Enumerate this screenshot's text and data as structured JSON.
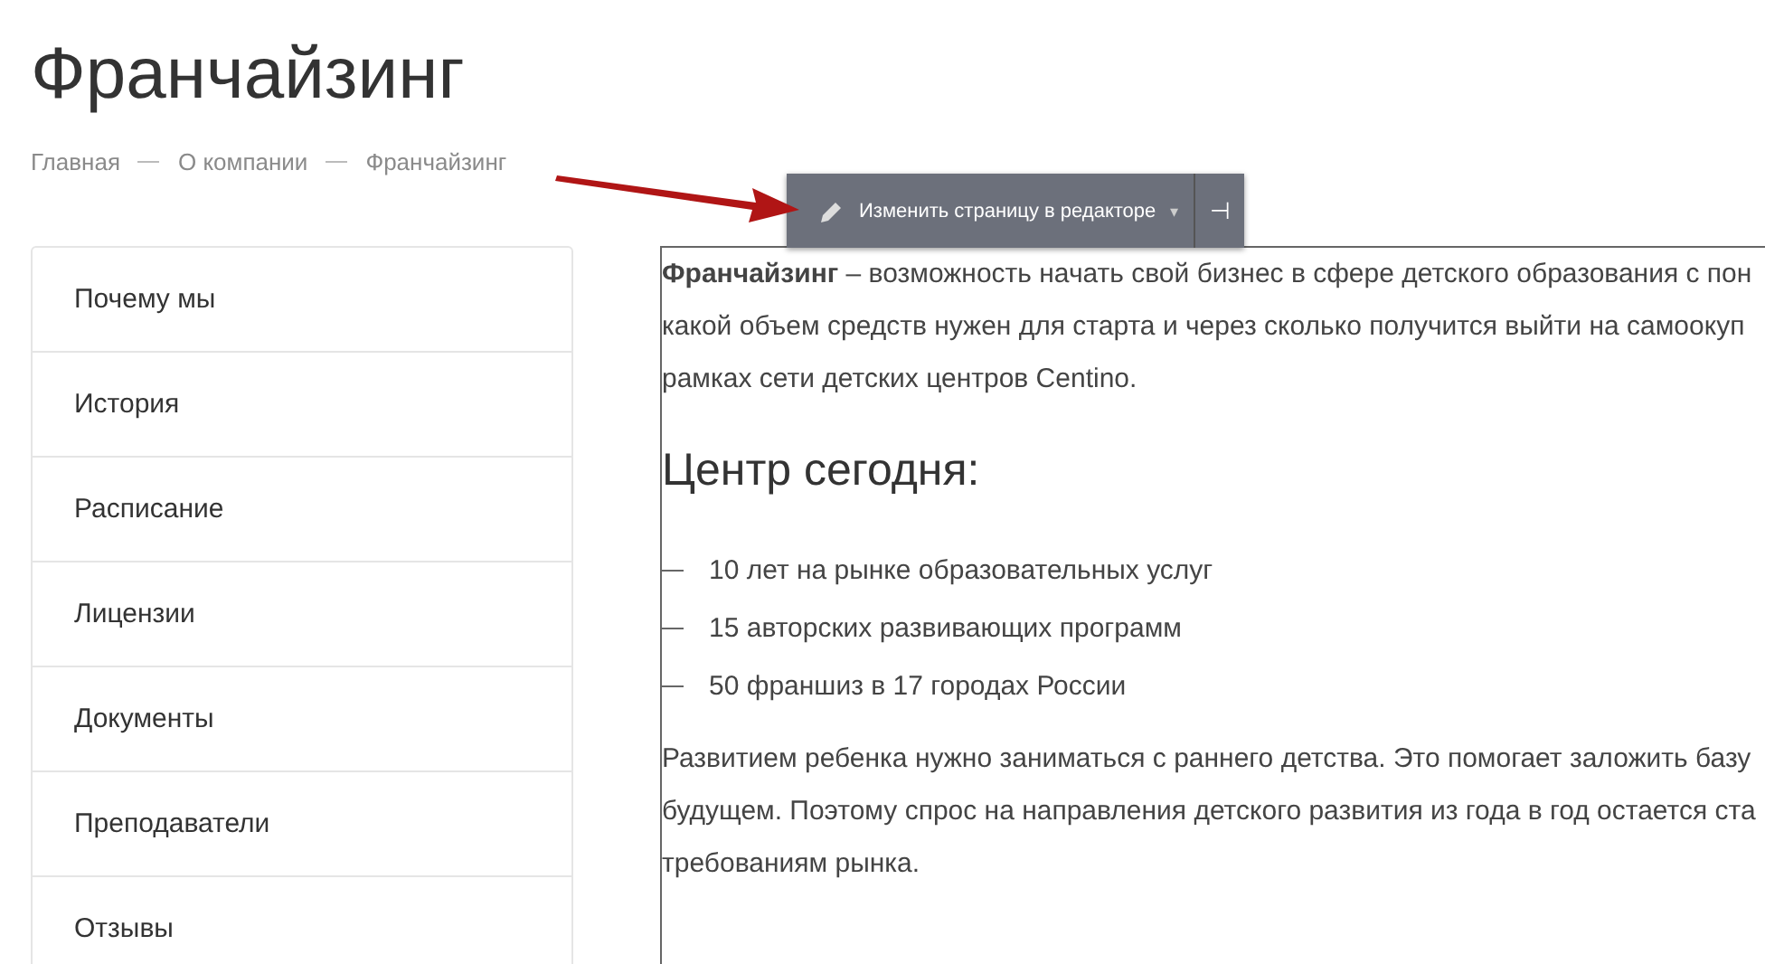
{
  "page_title": "Франчайзинг",
  "breadcrumbs": [
    "Главная",
    "О компании",
    "Франчайзинг"
  ],
  "editor_toolbar": {
    "label": "Изменить страницу в редакторе",
    "caret": "▾",
    "pin": "⊣"
  },
  "sidebar": {
    "items": [
      {
        "label": "Почему мы"
      },
      {
        "label": "История"
      },
      {
        "label": "Расписание"
      },
      {
        "label": "Лицензии"
      },
      {
        "label": "Документы"
      },
      {
        "label": "Преподаватели"
      },
      {
        "label": "Отзывы"
      }
    ]
  },
  "content": {
    "intro_lines": [
      "**Франчайзинг** – возможность начать свой бизнес в сфере детского образования с пон",
      "какой объем средств нужен для старта и через сколько получится выйти на самоокуп",
      "рамках сети детских центров Centino."
    ],
    "heading": "Центр сегодня:",
    "list": [
      "10 лет на рынке образовательных услуг",
      "15 авторских развивающих программ",
      "50 франшиз в 17 городах России"
    ],
    "para_lines": [
      "Развитием ребенка нужно заниматься с раннего детства. Это помогает заложить базу",
      "будущем. Поэтому спрос на направления детского развития из года в год остается ста",
      "требованиям рынка."
    ]
  }
}
